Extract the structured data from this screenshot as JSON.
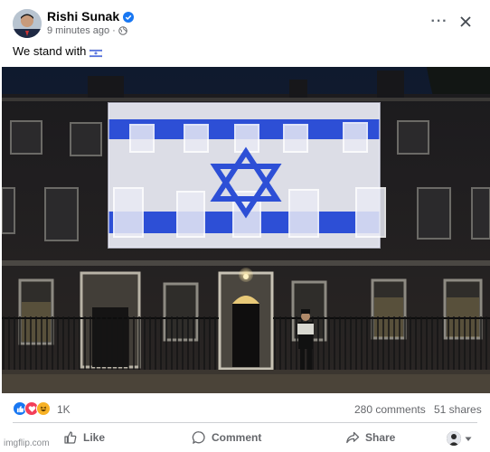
{
  "post": {
    "author_name": "Rishi Sunak",
    "timestamp": "9 minutes ago",
    "audience_icon": "globe-icon",
    "caption_text": "We stand with",
    "caption_emoji": "israel-flag-emoji",
    "photo_subject": "10 Downing Street with Israeli flag projection",
    "reaction_types": [
      "like",
      "love",
      "haha"
    ],
    "reaction_count": "1K",
    "comments": "280 comments",
    "shares": "51 shares"
  },
  "actions": {
    "like_label": "Like",
    "comment_label": "Comment",
    "share_label": "Share"
  },
  "watermark": "imgflip.com",
  "colors": {
    "facebook_blue": "#1877f2",
    "love_red": "#f33e58",
    "haha_yellow": "#f7b125",
    "secondary_text": "#65676b",
    "flag_blue": "#2d4fd6"
  }
}
